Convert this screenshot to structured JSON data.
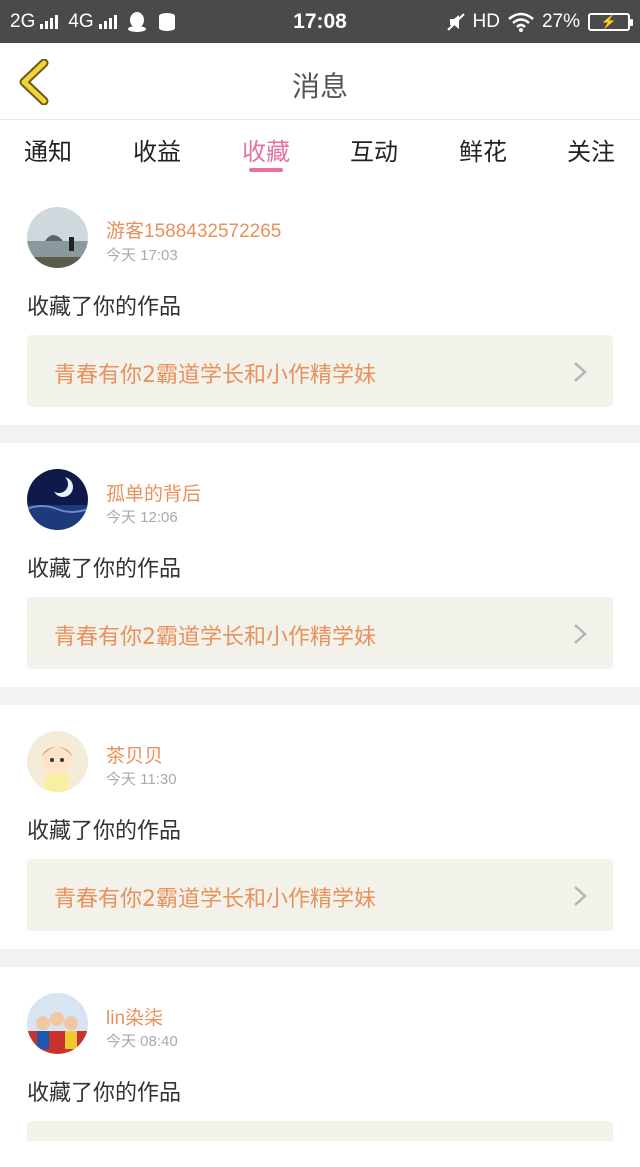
{
  "status_bar": {
    "net1": "2G",
    "net2": "4G",
    "time": "17:08",
    "hd": "HD",
    "battery": "27%"
  },
  "header": {
    "title": "消息"
  },
  "tabs": [
    {
      "label": "通知"
    },
    {
      "label": "收益"
    },
    {
      "label": "收藏"
    },
    {
      "label": "互动"
    },
    {
      "label": "鲜花"
    },
    {
      "label": "关注"
    }
  ],
  "active_tab": "收藏",
  "colors": {
    "accent": "#e573a1",
    "name": "#e8915c",
    "work_bg": "#f3f2ea",
    "status_bar": "#4a4a4a"
  },
  "messages": [
    {
      "user": "游客1588432572265",
      "time": "今天 17:03",
      "action": "收藏了你的作品",
      "work": "青春有你2霸道学长和小作精学妹"
    },
    {
      "user": "孤单的背后",
      "time": "今天 12:06",
      "action": "收藏了你的作品",
      "work": "青春有你2霸道学长和小作精学妹"
    },
    {
      "user": "茶贝贝",
      "time": "今天 11:30",
      "action": "收藏了你的作品",
      "work": "青春有你2霸道学长和小作精学妹"
    },
    {
      "user": "lin染柒",
      "time": "今天 08:40",
      "action": "收藏了你的作品",
      "work": ""
    }
  ]
}
